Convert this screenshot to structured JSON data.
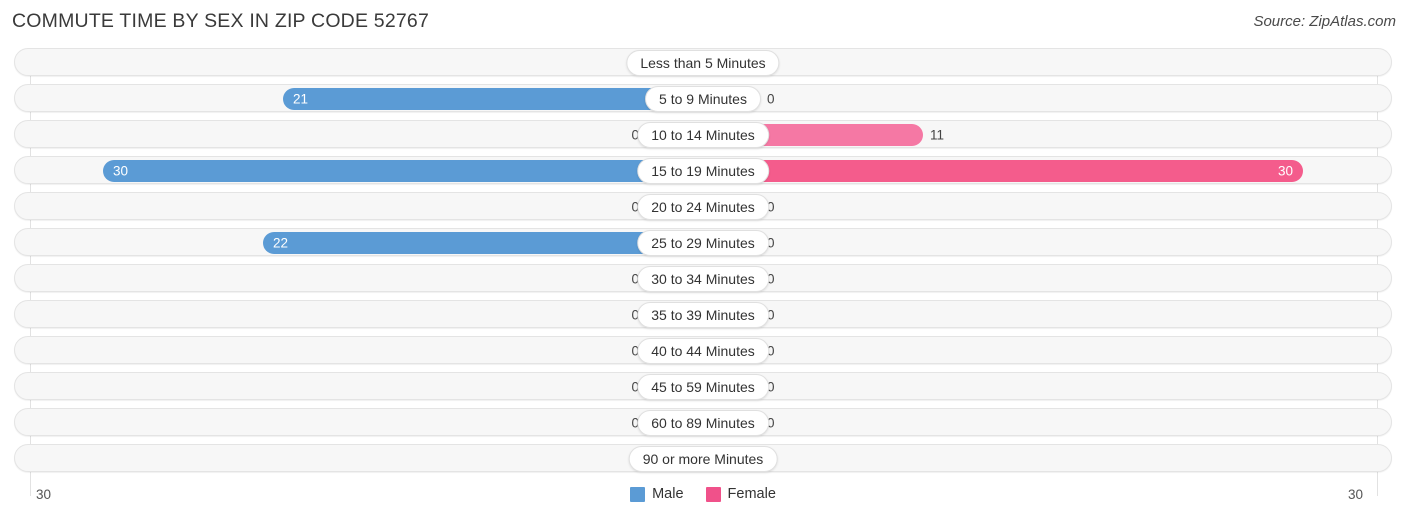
{
  "header": {
    "title": "COMMUTE TIME BY SEX IN ZIP CODE 52767",
    "source": "Source: ZipAtlas.com"
  },
  "axis": {
    "left_max_label": "30",
    "right_max_label": "30"
  },
  "legend": {
    "items": [
      {
        "label": "Male",
        "color": "#5B9BD5"
      },
      {
        "label": "Female",
        "color": "#F0518A"
      }
    ]
  },
  "colors": {
    "male_strong": "#5B9BD5",
    "male_pale": "#A6C8EC",
    "female_strong": "#F45C8C",
    "female_pale": "#F79AB9",
    "female_mid": "#F578A4",
    "track": "#f7f7f7",
    "track_border": "#e4e4e4",
    "gridline": "#e2e2e2"
  },
  "chart_data": {
    "type": "bar",
    "title": "COMMUTE TIME BY SEX IN ZIP CODE 52767",
    "subtitle": "Source: ZipAtlas.com",
    "orientation": "horizontal-diverging",
    "xlabel": "",
    "ylabel": "",
    "axis_max": 30,
    "xlim": [
      30,
      30
    ],
    "grid": true,
    "legend_position": "bottom-center",
    "categories": [
      "Less than 5 Minutes",
      "5 to 9 Minutes",
      "10 to 14 Minutes",
      "15 to 19 Minutes",
      "20 to 24 Minutes",
      "25 to 29 Minutes",
      "30 to 34 Minutes",
      "35 to 39 Minutes",
      "40 to 44 Minutes",
      "45 to 59 Minutes",
      "60 to 89 Minutes",
      "90 or more Minutes"
    ],
    "series": [
      {
        "name": "Male",
        "values": [
          0,
          21,
          0,
          30,
          0,
          22,
          0,
          0,
          0,
          0,
          0,
          0
        ]
      },
      {
        "name": "Female",
        "values": [
          0,
          0,
          11,
          30,
          0,
          0,
          0,
          0,
          0,
          0,
          0,
          0
        ]
      }
    ],
    "rows": [
      {
        "category": "Less than 5 Minutes",
        "male": 0,
        "male_label": "0",
        "female": 0,
        "female_label": "0"
      },
      {
        "category": "5 to 9 Minutes",
        "male": 21,
        "male_label": "21",
        "female": 0,
        "female_label": "0"
      },
      {
        "category": "10 to 14 Minutes",
        "male": 0,
        "male_label": "0",
        "female": 11,
        "female_label": "11"
      },
      {
        "category": "15 to 19 Minutes",
        "male": 30,
        "male_label": "30",
        "female": 30,
        "female_label": "30"
      },
      {
        "category": "20 to 24 Minutes",
        "male": 0,
        "male_label": "0",
        "female": 0,
        "female_label": "0"
      },
      {
        "category": "25 to 29 Minutes",
        "male": 22,
        "male_label": "22",
        "female": 0,
        "female_label": "0"
      },
      {
        "category": "30 to 34 Minutes",
        "male": 0,
        "male_label": "0",
        "female": 0,
        "female_label": "0"
      },
      {
        "category": "35 to 39 Minutes",
        "male": 0,
        "male_label": "0",
        "female": 0,
        "female_label": "0"
      },
      {
        "category": "40 to 44 Minutes",
        "male": 0,
        "male_label": "0",
        "female": 0,
        "female_label": "0"
      },
      {
        "category": "45 to 59 Minutes",
        "male": 0,
        "male_label": "0",
        "female": 0,
        "female_label": "0"
      },
      {
        "category": "60 to 89 Minutes",
        "male": 0,
        "male_label": "0",
        "female": 0,
        "female_label": "0"
      },
      {
        "category": "90 or more Minutes",
        "male": 0,
        "male_label": "0",
        "female": 0,
        "female_label": "0"
      }
    ]
  }
}
